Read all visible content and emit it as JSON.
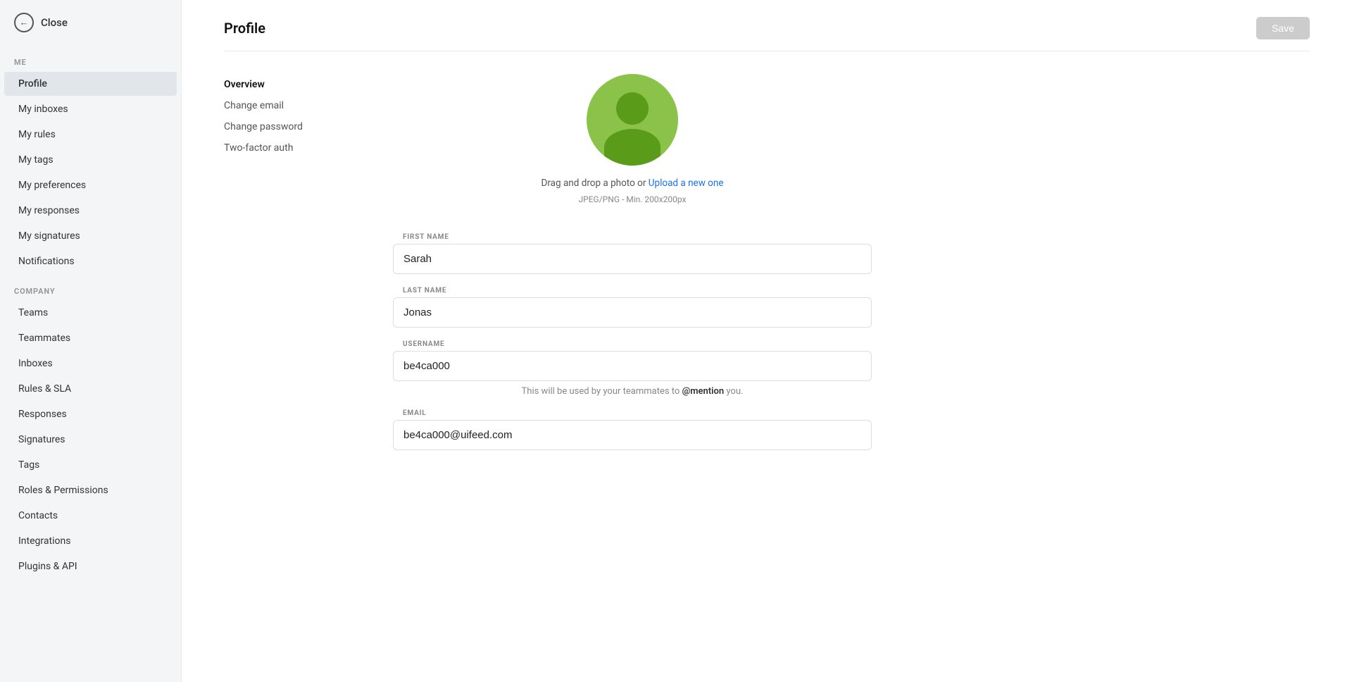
{
  "sidebar": {
    "close_label": "Close",
    "me_section_label": "ME",
    "me_items": [
      {
        "label": "Profile",
        "active": true
      },
      {
        "label": "My inboxes",
        "active": false
      },
      {
        "label": "My rules",
        "active": false
      },
      {
        "label": "My tags",
        "active": false
      },
      {
        "label": "My preferences",
        "active": false
      },
      {
        "label": "My responses",
        "active": false
      },
      {
        "label": "My signatures",
        "active": false
      },
      {
        "label": "Notifications",
        "active": false
      }
    ],
    "company_section_label": "COMPANY",
    "company_items": [
      {
        "label": "Teams",
        "active": false
      },
      {
        "label": "Teammates",
        "active": false
      },
      {
        "label": "Inboxes",
        "active": false
      },
      {
        "label": "Rules & SLA",
        "active": false
      },
      {
        "label": "Responses",
        "active": false
      },
      {
        "label": "Signatures",
        "active": false
      },
      {
        "label": "Tags",
        "active": false
      },
      {
        "label": "Roles & Permissions",
        "active": false
      },
      {
        "label": "Contacts",
        "active": false
      },
      {
        "label": "Integrations",
        "active": false
      },
      {
        "label": "Plugins & API",
        "active": false
      }
    ]
  },
  "main": {
    "title": "Profile",
    "save_label": "Save",
    "nav_items": [
      {
        "label": "Overview",
        "active": true
      },
      {
        "label": "Change email",
        "active": false
      },
      {
        "label": "Change password",
        "active": false
      },
      {
        "label": "Two-factor auth",
        "active": false
      }
    ],
    "avatar": {
      "drag_text": "Drag and drop a photo or ",
      "upload_link_text": "Upload a new one",
      "hint_text": "JPEG/PNG - Min. 200x200px"
    },
    "fields": {
      "first_name": {
        "label": "FIRST NAME",
        "value": "Sarah"
      },
      "last_name": {
        "label": "LAST NAME",
        "value": "Jonas"
      },
      "username": {
        "label": "USERNAME",
        "value": "be4ca000",
        "hint_prefix": "This will be used by your teammates to ",
        "hint_mention": "@mention",
        "hint_suffix": " you."
      },
      "email": {
        "label": "EMAIL",
        "value": "be4ca000@uifeed.com"
      }
    }
  }
}
